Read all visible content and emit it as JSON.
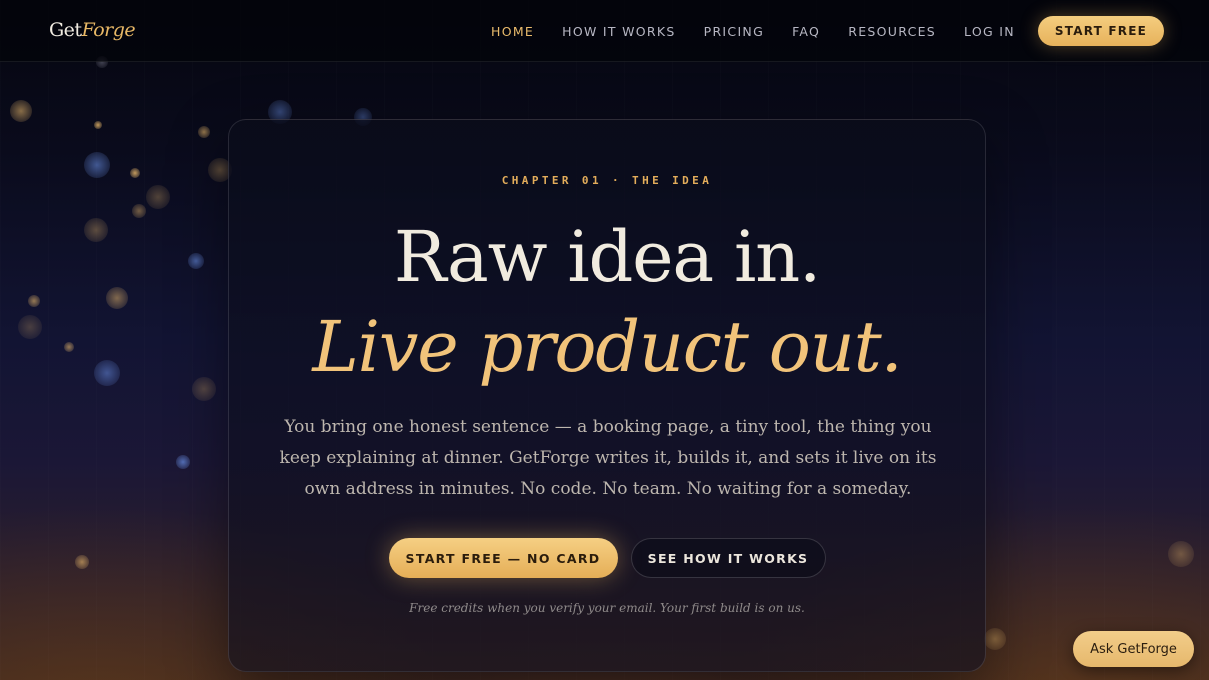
{
  "brand": {
    "logo_part1": "Get",
    "logo_part2": "Forge"
  },
  "nav": {
    "links": [
      {
        "label": "HOME",
        "active": true
      },
      {
        "label": "HOW IT WORKS",
        "active": false
      },
      {
        "label": "PRICING",
        "active": false
      },
      {
        "label": "FAQ",
        "active": false
      },
      {
        "label": "RESOURCES",
        "active": false
      },
      {
        "label": "LOG IN",
        "active": false
      }
    ],
    "cta_label": "START FREE"
  },
  "hero": {
    "eyebrow": "CHAPTER 01 · THE IDEA",
    "headline_line1": "Raw idea in.",
    "headline_line2": "Live product out.",
    "lede": "You bring one honest sentence — a booking page, a tiny tool, the thing you keep explaining at dinner. GetForge writes it, builds it, and sets it live on its own address in minutes. No code. No team. No waiting for a someday.",
    "primary_cta": "START FREE — NO CARD",
    "secondary_cta": "SEE HOW IT WORKS",
    "footnote": "Free credits when you verify your email. Your first build is on us."
  },
  "assistant": {
    "label": "Ask GetForge"
  },
  "colors": {
    "accent_gold": "#e9bb6c",
    "headline_gold": "#f1c37a",
    "background_navy": "#0a0b1c"
  }
}
